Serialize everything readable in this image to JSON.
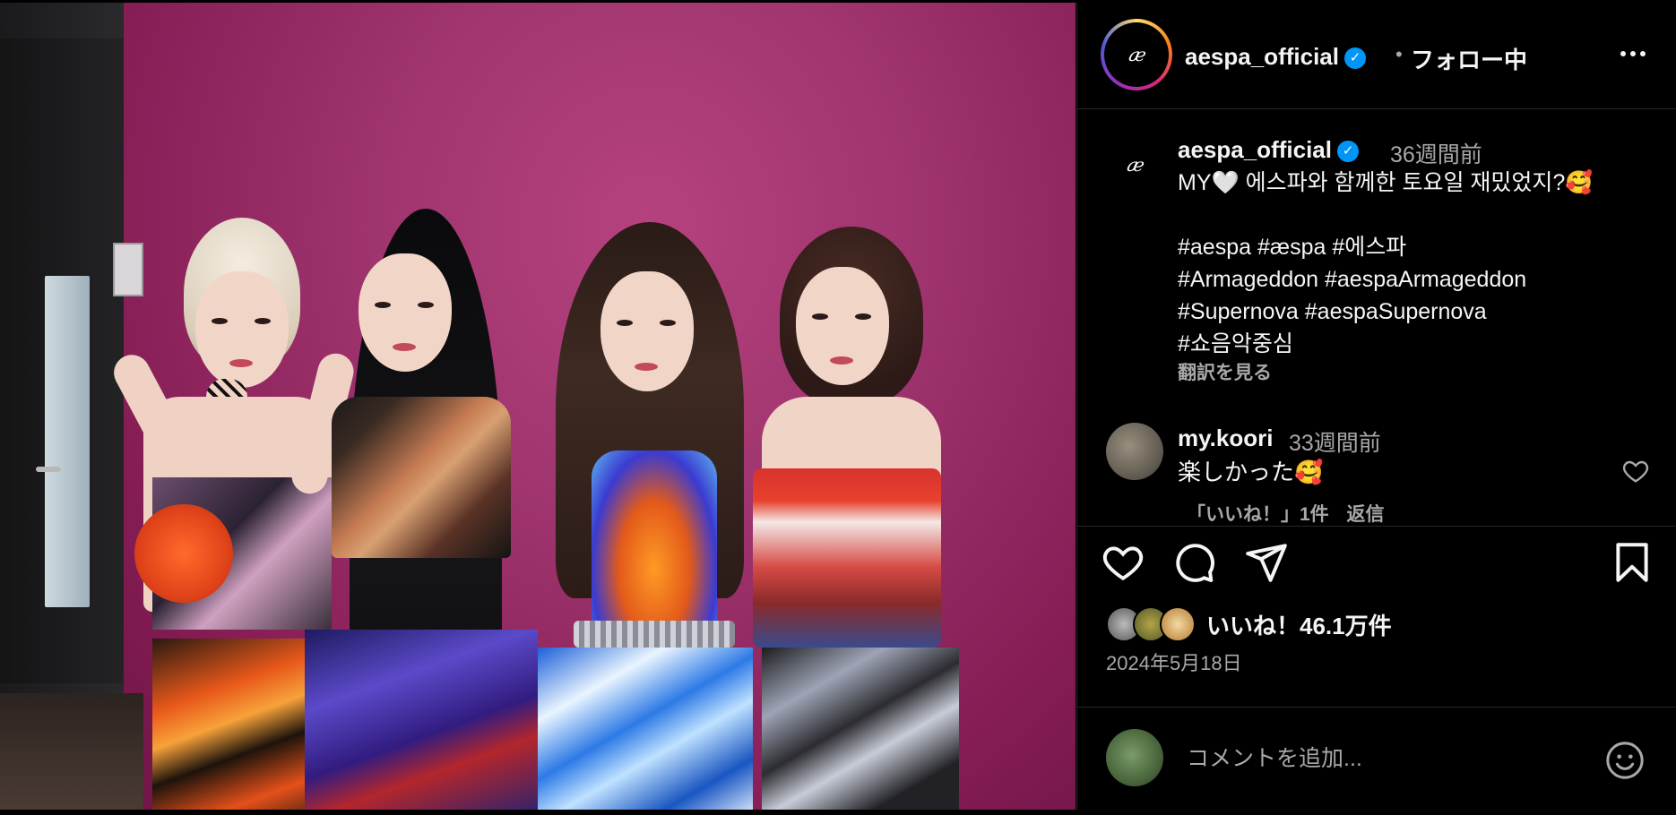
{
  "header": {
    "username": "aespa_official",
    "verified_icon": "✓",
    "separator": "•",
    "follow_status": "フォロー中",
    "avatar_logo": "æ"
  },
  "caption": {
    "username": "aespa_official",
    "time": "36週間前",
    "text": "MY🤍 에스파와 함께한 토요일 재밌었지?🥰\n\n#aespa #æspa #에스파\n#Armageddon #aespaArmageddon\n#Supernova #aespaSupernova\n#쇼음악중심",
    "translate_label": "翻訳を見る"
  },
  "comment": {
    "username": "my.koori",
    "time": "33週間前",
    "text": "楽しかった🥰",
    "likes": "「いいね！」1件",
    "reply": "返信"
  },
  "likes": {
    "text": "いいね！46.1万件"
  },
  "date": "2024年5月18日",
  "add_comment": {
    "placeholder": "コメントを追加..."
  },
  "colors": {
    "background": "#000000",
    "text": "#f5f5f5",
    "secondary": "#a8a8a8",
    "verified": "#0095f6"
  }
}
